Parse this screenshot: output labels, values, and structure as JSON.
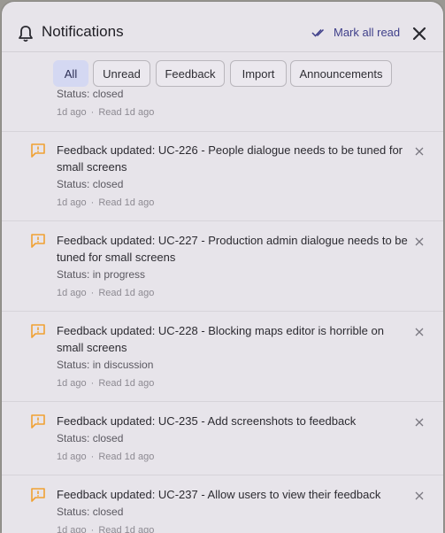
{
  "header": {
    "title": "Notifications",
    "mark_all": "Mark all read"
  },
  "filters": [
    "All",
    "Unread",
    "Feedback",
    "Import",
    "Announcements"
  ],
  "partial": {
    "status": "Status: closed",
    "time": "1d ago",
    "read": "Read 1d ago"
  },
  "items": [
    {
      "title": "Feedback updated: UC-226 - People dialogue needs to be tuned for small screens",
      "status": "Status: closed",
      "time": "1d ago",
      "read": "Read 1d ago"
    },
    {
      "title": "Feedback updated: UC-227 - Production admin dialogue needs to be tuned for small screens",
      "status": "Status: in progress",
      "time": "1d ago",
      "read": "Read 1d ago"
    },
    {
      "title": "Feedback updated: UC-228 - Blocking maps editor is horrible on small screens",
      "status": "Status: in discussion",
      "time": "1d ago",
      "read": "Read 1d ago"
    },
    {
      "title": "Feedback updated: UC-235 - Add screenshots to feedback",
      "status": "Status: closed",
      "time": "1d ago",
      "read": "Read 1d ago"
    },
    {
      "title": "Feedback updated: UC-237 - Allow users to view their feedback",
      "status": "Status: closed",
      "time": "1d ago",
      "read": "Read 1d ago"
    }
  ],
  "colors": {
    "accent": "#3f3f8a",
    "feedback_icon": "#f0a133",
    "active_chip": "#d4d8f2"
  }
}
